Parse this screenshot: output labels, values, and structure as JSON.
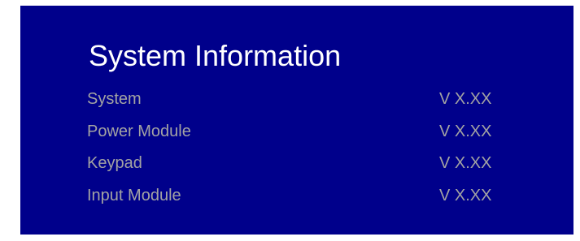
{
  "screen": {
    "title": "System Information",
    "background_color": "#00008b",
    "title_color": "#ffffff",
    "text_color": "#a3a3a3"
  },
  "rows": [
    {
      "label": "System",
      "version": "V X.XX"
    },
    {
      "label": "Power Module",
      "version": "V X.XX"
    },
    {
      "label": "Keypad",
      "version": "V X.XX"
    },
    {
      "label": "Input Module",
      "version": "V X.XX"
    }
  ]
}
